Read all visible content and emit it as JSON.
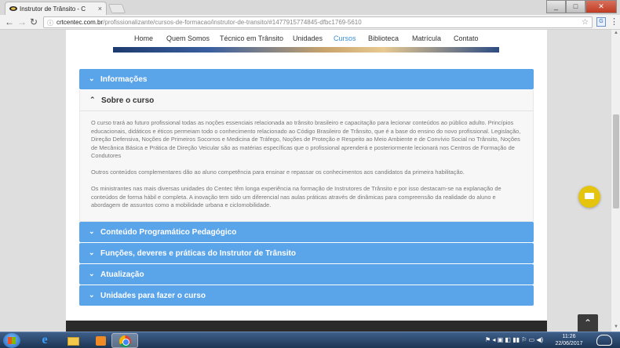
{
  "browser": {
    "tab_title": "Instrutor de Trânsito - C",
    "tab_close": "×",
    "url_domain": "crtcentec.com.br",
    "url_path": "/profissionalizante/cursos-de-formacao/instrutor-de-transito/#1477915774845-dfbc1769-5610",
    "win_min": "_",
    "win_max": "□",
    "win_close": "✕",
    "back_icon": "←",
    "forward_icon": "→",
    "reload_icon": "↻",
    "star_icon": "☆",
    "ext_icon": "G",
    "menu_icon": "⋮",
    "lock_icon": "ⓘ"
  },
  "nav": {
    "items": [
      {
        "label": "Home"
      },
      {
        "label": "Quem Somos"
      },
      {
        "label": "Técnico em Trânsito"
      },
      {
        "label": "Unidades"
      },
      {
        "label": "Cursos",
        "active": true
      },
      {
        "label": "Biblioteca"
      },
      {
        "label": "Matrícula"
      },
      {
        "label": "Contato"
      }
    ]
  },
  "accordion": {
    "chev_collapsed": "⌄",
    "chev_open": "⌃",
    "informacoes": "Informações",
    "sobre": "Sobre o curso",
    "paragraphs": [
      "O curso trará ao futuro profissional todas as noções essenciais relacionada ao trânsito brasileiro e capacitação para lecionar conteúdos ao público adulto. Princípios educacionais, didáticos e éticos permeiam todo o conhecimento relacionado ao Código Brasileiro de Trânsito, que é a base do ensino do novo profissional. Legislação, Direção Defensiva, Noções de Primeiros Socorros e Medicina de Tráfego, Noções de Proteção e Respeito ao Meio Ambiente e de Convívio Social no Trânsito, Noções de Mecânica Básica e Prática de Direção Veicular são as matérias específicas que o profissional aprenderá e posteriormente lecionará nos Centros de Formação de Condutores",
      "Outros conteúdos complementares dão ao aluno competência para ensinar e repassar os conhecimentos aos candidatos da primeira habilitação.",
      "Os ministrantes nas mais diversas unidades do Centec têm longa experiência na formação de Instrutores de Trânsito e por isso destacam-se na explanação de conteúdos de forma hábil e completa. A inovação tem sido um diferencial nas aulas práticas através de dinâmicas para compreensão da realidade do aluno e abordagem de assuntos como a mobilidade urbana e ciclomobilidade."
    ],
    "conteudo": "Conteúdo Programático Pedagógico",
    "funcoes": "Funções, deveres e práticas do Instrutor de Trânsito",
    "atualizacao": "Atualização",
    "unidades": "Unidades para fazer o curso"
  },
  "widgets": {
    "back_to_top": "⌃"
  },
  "taskbar": {
    "ie_label": "e",
    "tray_icons": "⚑ ◂ ▣ ◧ ▮▮ ⚐ ▭ ◀)",
    "time": "11:26",
    "date": "22/06/2017"
  },
  "colors": {
    "accent": "#5aa4ea",
    "nav_active": "#3a8fd8",
    "chat": "#e5c40d"
  }
}
